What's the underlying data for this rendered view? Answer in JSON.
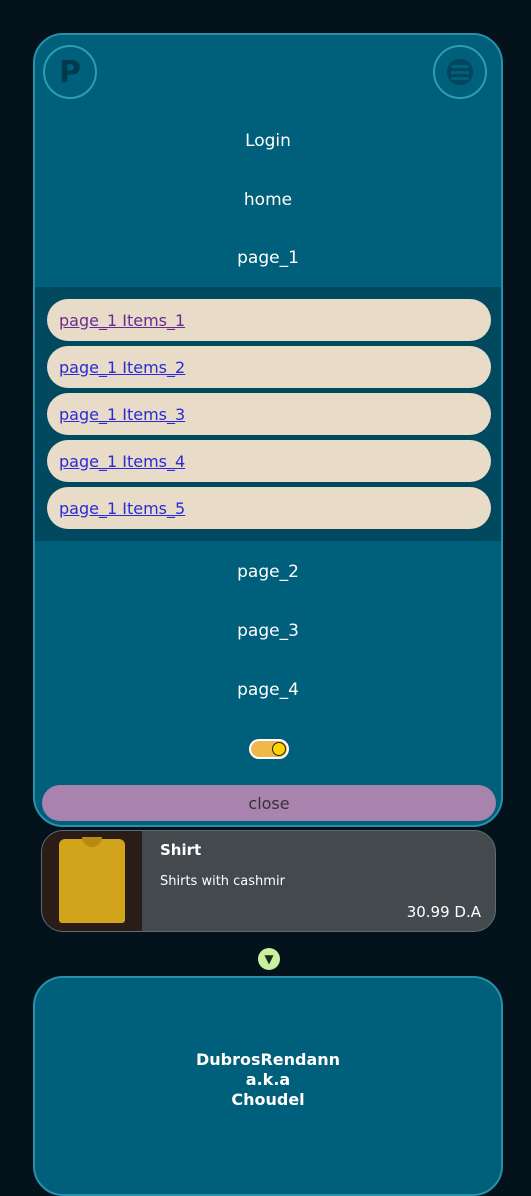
{
  "header": {
    "logo_letter": "P"
  },
  "nav": {
    "items": [
      "Login",
      "home",
      "page_1"
    ],
    "sub_items": [
      "page_1 Items_1",
      "page_1 Items_2",
      "page_1 Items_3",
      "page_1 Items_4",
      "page_1 Items_5"
    ],
    "items_after": [
      "page_2",
      "page_3",
      "page_4"
    ],
    "close_label": "close"
  },
  "product": {
    "title": "Shirt",
    "description": "Shirts with cashmir",
    "price": "30.99 D.A"
  },
  "footer": {
    "line1": "DubrosRendann",
    "line2": "a.k.a",
    "line3": "Choudel"
  },
  "colors": {
    "panel": "#005f7a",
    "submenu": "#00495f",
    "pill": "#e8dcc8",
    "close": "#a883ad",
    "toggle": "#f0b84a"
  }
}
